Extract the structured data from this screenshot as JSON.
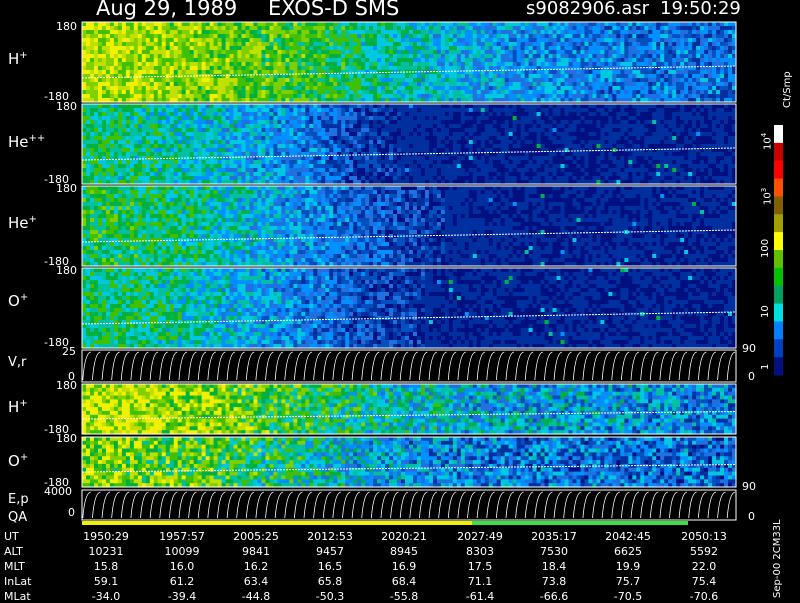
{
  "header": {
    "date": "Aug 29, 1989",
    "mission": "EXOS-D SMS",
    "file": "s9082906.asr",
    "time": "19:50:29"
  },
  "panels": [
    {
      "ion": "H",
      "charge": "+",
      "top": "180",
      "bottom": "-180"
    },
    {
      "ion": "He",
      "charge": "++",
      "top": "180",
      "bottom": "-180"
    },
    {
      "ion": "He",
      "charge": "+",
      "top": "180",
      "bottom": "-180"
    },
    {
      "ion": "O",
      "charge": "+",
      "top": "180",
      "bottom": "-180"
    }
  ],
  "vr_panel": {
    "label": "V,r",
    "top": "25",
    "bottom": "0",
    "right_top": "90",
    "right_bottom": "0"
  },
  "lower_panels": [
    {
      "ion": "H",
      "charge": "+",
      "top": "180",
      "bottom": "-180"
    },
    {
      "ion": "O",
      "charge": "+",
      "top": "180",
      "bottom": "-180"
    }
  ],
  "ep_panel": {
    "label": "E,p",
    "top": "4000",
    "bottom": "0",
    "right_top": "90",
    "right_bottom": "0"
  },
  "qa_label": "QA",
  "colorbar": {
    "unit": "Ct/Smp",
    "ticks": [
      "10",
      "10",
      "100",
      "10",
      "1"
    ],
    "tick_exponents": [
      "4",
      "3",
      "",
      "",
      ""
    ],
    "colors": [
      "#ffffff",
      "#c80000",
      "#ff0000",
      "#ff5000",
      "#806000",
      "#a0a000",
      "#ffff00",
      "#60c000",
      "#00c000",
      "#00a060",
      "#00e0e0",
      "#0080ff",
      "#0040c0",
      "#001080"
    ]
  },
  "footer": {
    "rows": [
      {
        "label": "UT",
        "values": [
          "1950:29",
          "1957:57",
          "2005:25",
          "2012:53",
          "2020:21",
          "2027:49",
          "2035:17",
          "2042:45",
          "2050:13"
        ]
      },
      {
        "label": "ALT",
        "values": [
          "10231",
          "10099",
          "9841",
          "9457",
          "8945",
          "8303",
          "7530",
          "6625",
          "5592"
        ]
      },
      {
        "label": "MLT",
        "values": [
          "15.8",
          "16.0",
          "16.2",
          "16.5",
          "16.9",
          "17.5",
          "18.4",
          "19.9",
          "22.0"
        ]
      },
      {
        "label": "InLat",
        "values": [
          "59.1",
          "61.2",
          "63.4",
          "65.8",
          "68.4",
          "71.1",
          "73.8",
          "75.7",
          "75.4"
        ]
      },
      {
        "label": "MLat",
        "values": [
          "-34.0",
          "-39.4",
          "-44.8",
          "-50.3",
          "-55.8",
          "-61.4",
          "-66.6",
          "-70.5",
          "-70.6"
        ]
      }
    ]
  },
  "side_note": "Sep-00 2CM33L",
  "chart_data": {
    "type": "heatmap",
    "title": "Aug 29, 1989   EXOS-D SMS",
    "x_ticks": [
      "1950:29",
      "1957:57",
      "2005:25",
      "2012:53",
      "2020:21",
      "2027:49",
      "2035:17",
      "2042:45",
      "2050:13"
    ],
    "y_range": [
      -180,
      180
    ],
    "series": [
      {
        "name": "H+",
        "intensity_profile": [
          0.9,
          0.85,
          0.8,
          0.7,
          0.55,
          0.45,
          0.35,
          0.3,
          0.28,
          0.26
        ]
      },
      {
        "name": "He++",
        "intensity_profile": [
          0.6,
          0.55,
          0.45,
          0.3,
          0.1,
          0.05,
          0.05,
          0.05,
          0.05,
          0.05
        ]
      },
      {
        "name": "He+",
        "intensity_profile": [
          0.65,
          0.6,
          0.5,
          0.35,
          0.2,
          0.08,
          0.05,
          0.05,
          0.05,
          0.05
        ]
      },
      {
        "name": "O+",
        "intensity_profile": [
          0.6,
          0.58,
          0.45,
          0.3,
          0.15,
          0.05,
          0.05,
          0.05,
          0.05,
          0.05
        ]
      }
    ],
    "colorbar_range": [
      1,
      10000
    ],
    "colorbar_scale": "log"
  }
}
